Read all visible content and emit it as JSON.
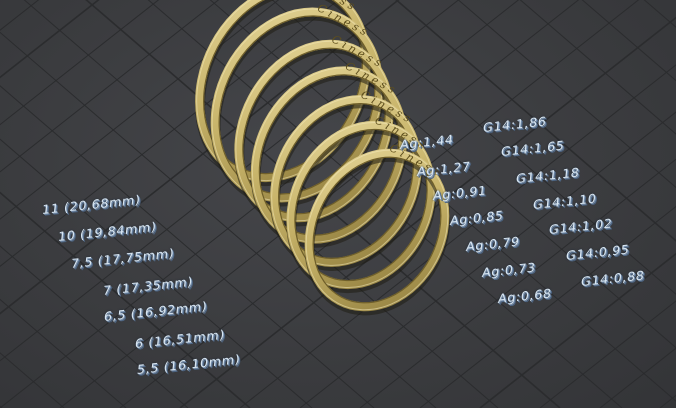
{
  "viewport": {
    "name": "3D viewport",
    "background_color": "#3b3c3f",
    "grid_color": "#2b2c2e",
    "ring_color": "#c8b46a",
    "label_color": "#d8e6f2"
  },
  "ring": {
    "engraving": "C i n e s s"
  },
  "sizes": [
    "11 (20,68mm)",
    "10 (19,84mm)",
    "7,5 (17,75mm)",
    "7 (17,35mm)",
    "6,5 (16,92mm)",
    "6 (16,51mm)",
    "5,5 (16,10mm)"
  ],
  "weights": [
    {
      "ag": "Ag:1,44",
      "g14": "G14:1,86"
    },
    {
      "ag": "Ag:1,27",
      "g14": "G14:1,65"
    },
    {
      "ag": "Ag:0,91",
      "g14": "G14:1,18"
    },
    {
      "ag": "Ag:0,85",
      "g14": "G14:1,10"
    },
    {
      "ag": "Ag:0,79",
      "g14": "G14:1,02"
    },
    {
      "ag": "Ag:0,73",
      "g14": "G14:0,95"
    },
    {
      "ag": "Ag:0,68",
      "g14": "G14:0,88"
    }
  ]
}
